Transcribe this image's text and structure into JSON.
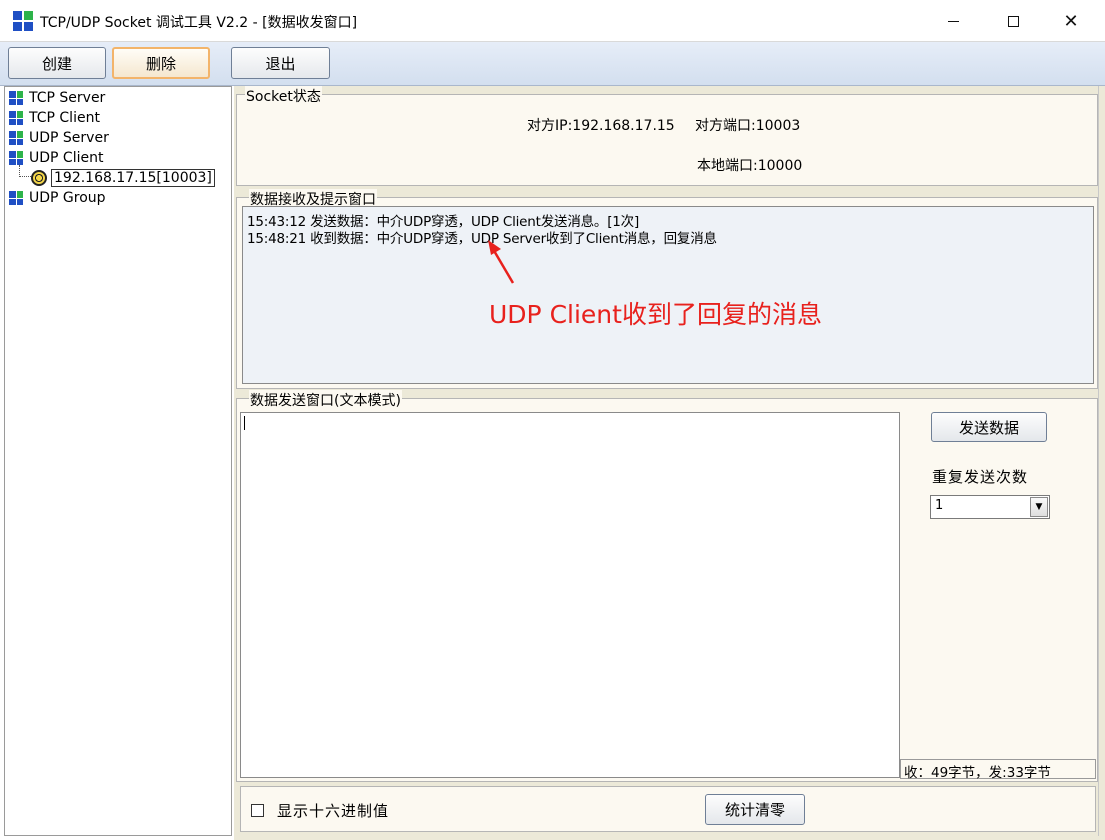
{
  "window": {
    "title": "TCP/UDP Socket 调试工具 V2.2 - [数据收发窗口]",
    "minimize": "",
    "maximize": "",
    "close": "✕"
  },
  "toolbar": {
    "create": "创建",
    "delete": "删除",
    "exit": "退出"
  },
  "tree": {
    "items": [
      "TCP Server",
      "TCP Client",
      "UDP Server",
      "UDP Client",
      "192.168.17.15[10003]",
      "UDP Group"
    ]
  },
  "socket_status": {
    "legend": "Socket状态",
    "remote_ip": "对方IP:192.168.17.15",
    "remote_port": "对方端口:10003",
    "local_port": "本地端口:10000"
  },
  "receive": {
    "legend": "数据接收及提示窗口",
    "lines": [
      "15:43:12 发送数据：中介UDP穿透，UDP Client发送消息。[1次]",
      "15:48:21 收到数据：中介UDP穿透，UDP Server收到了Client消息，回复消息"
    ],
    "annotation": "UDP Client收到了回复的消息"
  },
  "send": {
    "legend": "数据发送窗口(文本模式)",
    "send_button": "发送数据",
    "repeat_label": "重复发送次数",
    "repeat_value": "1",
    "counter": "收：49字节，发:33字节"
  },
  "bottom": {
    "hex_checkbox": "显示十六进制值",
    "reset_button": "统计清零"
  },
  "colors": {
    "icon_blue": "#1f4fc4",
    "icon_green": "#2db34a",
    "annotation_red": "#e8211d"
  }
}
